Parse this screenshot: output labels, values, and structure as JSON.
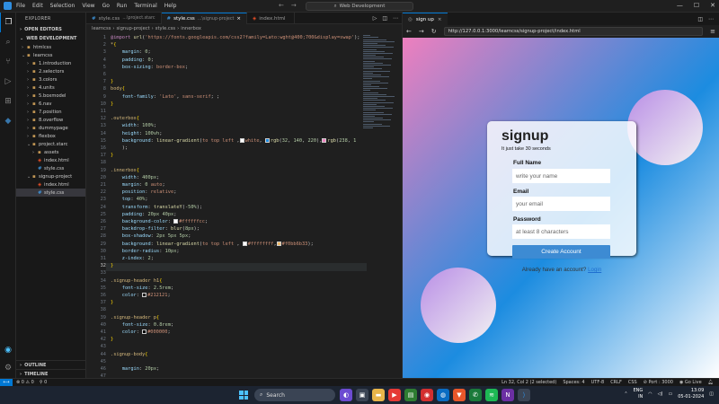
{
  "titlebar": {
    "menu": [
      "File",
      "Edit",
      "Selection",
      "View",
      "Go",
      "Run",
      "Terminal",
      "Help"
    ],
    "command_center": "Web Development",
    "nav_back": "←",
    "nav_fwd": "→"
  },
  "sidebar": {
    "header": "EXPLORER",
    "open_editors": "OPEN EDITORS",
    "workspace": "WEB DEVELOPMENT",
    "items": [
      {
        "label": "htmlcss",
        "indent": 1,
        "type": "folder",
        "chev": "›"
      },
      {
        "label": "learncss",
        "indent": 1,
        "type": "folder",
        "chev": "⌄"
      },
      {
        "label": "1.introduction",
        "indent": 2,
        "type": "folder",
        "chev": "›"
      },
      {
        "label": "2.selectors",
        "indent": 2,
        "type": "folder",
        "chev": "›"
      },
      {
        "label": "3.colors",
        "indent": 2,
        "type": "folder",
        "chev": "›"
      },
      {
        "label": "4.units",
        "indent": 2,
        "type": "folder",
        "chev": "›"
      },
      {
        "label": "5.boxmodel",
        "indent": 2,
        "type": "folder",
        "chev": "›"
      },
      {
        "label": "6.nav",
        "indent": 2,
        "type": "folder",
        "chev": "›"
      },
      {
        "label": "7.position",
        "indent": 2,
        "type": "folder",
        "chev": "›"
      },
      {
        "label": "8.overflow",
        "indent": 2,
        "type": "folder",
        "chev": "›"
      },
      {
        "label": "dummypage",
        "indent": 2,
        "type": "folder",
        "chev": "›"
      },
      {
        "label": "flexbox",
        "indent": 2,
        "type": "folder",
        "chev": "›"
      },
      {
        "label": "project.starc",
        "indent": 2,
        "type": "folder",
        "chev": "⌄"
      },
      {
        "label": "assets",
        "indent": 3,
        "type": "folder",
        "chev": "›"
      },
      {
        "label": "index.html",
        "indent": 3,
        "type": "html",
        "chev": ""
      },
      {
        "label": "style.css",
        "indent": 3,
        "type": "css",
        "chev": ""
      },
      {
        "label": "signup-project",
        "indent": 2,
        "type": "folder",
        "chev": "⌄"
      },
      {
        "label": "index.html",
        "indent": 3,
        "type": "html",
        "chev": ""
      },
      {
        "label": "style.css",
        "indent": 3,
        "type": "css",
        "chev": "",
        "selected": true
      }
    ],
    "outline": "OUTLINE",
    "timeline": "TIMELINE"
  },
  "editor": {
    "tabs": [
      {
        "label": "style.css",
        "sub": "...\\project.starc",
        "active": false,
        "icon": "css"
      },
      {
        "label": "style.css",
        "sub": "...\\signup-project",
        "active": true,
        "icon": "css",
        "close": "×"
      },
      {
        "label": "index.html",
        "sub": "",
        "active": false,
        "icon": "html"
      }
    ],
    "breadcrumb": [
      "learncss",
      "signup-project",
      "style.css",
      "innerbox"
    ],
    "breadcrumb_sep": "›",
    "code": [
      {
        "n": 1,
        "html": "<span class='t-at'>@import</span> <span class='t-fn'>url</span>(<span class='t-str'>'https://fonts.googleapis.com/css2?family=Lato:wght@400;700&display=swap'</span>);"
      },
      {
        "n": 2,
        "html": "<span class='t-sel'>*</span><span class='t-br'>{</span>"
      },
      {
        "n": 3,
        "html": "    <span class='t-prop'>margin</span>: <span class='t-num'>0</span>;"
      },
      {
        "n": 4,
        "html": "    <span class='t-prop'>padding</span>: <span class='t-num'>0</span>;"
      },
      {
        "n": 5,
        "html": "    <span class='t-prop'>box-sizing</span>: <span class='t-val'>border-box</span>;"
      },
      {
        "n": 6,
        "html": ""
      },
      {
        "n": 7,
        "html": "<span class='t-br'>}</span>"
      },
      {
        "n": 8,
        "html": "<span class='t-sel'>body</span><span class='t-br'>{</span>"
      },
      {
        "n": 9,
        "html": "    <span class='t-prop'>font-family</span>: <span class='t-str'>'Lato'</span>, <span class='t-val'>sans-serif</span>; ;"
      },
      {
        "n": 10,
        "html": "<span class='t-br'>}</span>"
      },
      {
        "n": 11,
        "html": ""
      },
      {
        "n": 12,
        "html": "<span class='t-sel'>.outerbox</span><span class='t-br'>{</span>"
      },
      {
        "n": 13,
        "html": "    <span class='t-prop'>width</span>: <span class='t-num'>100%</span>;"
      },
      {
        "n": 14,
        "html": "    <span class='t-prop'>height</span>: <span class='t-num'>100vh</span>;"
      },
      {
        "n": 15,
        "html": "    <span class='t-prop'>background</span>: <span class='t-fn'>linear-gradient</span>(<span class='t-val'>to top left</span> ,<span class='sw' style='background:#fff'></span><span class='t-val'>white</span>, <span class='sw' style='background:#1c8ce0'></span><span class='t-fn'>rgb</span>(<span class='t-num'>32</span>, <span class='t-num'>140</span>, <span class='t-num'>220</span>),<span class='sw' style='background:#ee7fbe'></span><span class='t-fn'>rgb</span>(<span class='t-num'>238</span>, <span class='t-num'>1</span>"
      },
      {
        "n": 16,
        "html": "    );"
      },
      {
        "n": 17,
        "html": "<span class='t-br'>}</span>"
      },
      {
        "n": 18,
        "html": ""
      },
      {
        "n": 19,
        "html": "<span class='t-sel'>.innerbox</span><span class='t-br'>{</span>"
      },
      {
        "n": 20,
        "html": "    <span class='t-prop'>width</span>: <span class='t-num'>400px</span>;"
      },
      {
        "n": 21,
        "html": "    <span class='t-prop'>margin</span>: <span class='t-num'>0</span> <span class='t-val'>auto</span>;"
      },
      {
        "n": 22,
        "html": "    <span class='t-prop'>position</span>: <span class='t-val'>relative</span>;"
      },
      {
        "n": 23,
        "html": "    <span class='t-prop'>top</span>: <span class='t-num'>40%</span>;"
      },
      {
        "n": 24,
        "html": "    <span class='t-prop'>transform</span>: <span class='t-fn'>translateY</span>(<span class='t-num'>-50%</span>);"
      },
      {
        "n": 25,
        "html": "    <span class='t-prop'>padding</span>: <span class='t-num'>20px</span> <span class='t-num'>40px</span>;"
      },
      {
        "n": 26,
        "html": "    <span class='t-prop'>background-color</span>: <span class='sw' style='background:#fff'></span><span class='t-val'>#ffffffcc</span>;"
      },
      {
        "n": 27,
        "html": "    <span class='t-prop'>backdrop-filter</span>: <span class='t-fn'>blur</span>(<span class='t-num'>8px</span>);"
      },
      {
        "n": 28,
        "html": "    <span class='t-prop'>box-shadow</span>: <span class='t-num'>2px</span> <span class='t-num'>5px</span> <span class='t-num'>5px</span>;"
      },
      {
        "n": 29,
        "html": "    <span class='t-prop'>background</span>: <span class='t-fn'>linear-gradient</span>(<span class='t-val'>to top left</span> , <span class='sw' style='background:#fff'></span><span class='t-val'>#ffffffff</span>,<span class='sw' style='background:#f0bb6b'></span><span class='t-val'>#f0bb6b33</span>);"
      },
      {
        "n": 30,
        "html": "    <span class='t-prop'>border-radius</span>: <span class='t-num'>10px</span>;"
      },
      {
        "n": 31,
        "html": "    <span class='t-prop'>z-index</span>: <span class='t-num'>2</span>;"
      },
      {
        "n": 32,
        "html": "<span class='t-br'>}</span>",
        "cur": true
      },
      {
        "n": 33,
        "html": ""
      },
      {
        "n": 34,
        "html": "<span class='t-sel'>.signup-header h1</span><span class='t-br'>{</span>"
      },
      {
        "n": 35,
        "html": "    <span class='t-prop'>font-size</span>: <span class='t-num'>2.5rem</span>;"
      },
      {
        "n": 36,
        "html": "    <span class='t-prop'>color</span>: <span class='sw' style='background:#212121'></span><span class='t-val'>#212121</span>;"
      },
      {
        "n": 37,
        "html": "<span class='t-br'>}</span>"
      },
      {
        "n": 38,
        "html": ""
      },
      {
        "n": 39,
        "html": "<span class='t-sel'>.signup-header p</span><span class='t-br'>{</span>"
      },
      {
        "n": 40,
        "html": "    <span class='t-prop'>font-size</span>: <span class='t-num'>0.8rem</span>;"
      },
      {
        "n": 41,
        "html": "    <span class='t-prop'>color</span>: <span class='sw' style='background:#000'></span><span class='t-val'>#000000</span>;"
      },
      {
        "n": 42,
        "html": "<span class='t-br'>}</span>"
      },
      {
        "n": 43,
        "html": ""
      },
      {
        "n": 44,
        "html": "<span class='t-sel'>.signup-body</span><span class='t-br'>{</span>"
      },
      {
        "n": 45,
        "html": ""
      },
      {
        "n": 46,
        "html": "    <span class='t-prop'>margin</span>: <span class='t-num'>20px</span>;"
      },
      {
        "n": 47,
        "html": ""
      },
      {
        "n": 48,
        "html": "<span class='t-br'>}</span>"
      }
    ]
  },
  "browser": {
    "tab_label": "sign up",
    "url": "http://127.0.0.1:3000/learncss/signup-project/index.html"
  },
  "signup": {
    "title": "signup",
    "subtitle": "It just take 30 seconds",
    "fields": [
      {
        "label": "Full Name",
        "placeholder": "write your name"
      },
      {
        "label": "Email",
        "placeholder": "your email"
      },
      {
        "label": "Password",
        "placeholder": "at least 8 characters"
      }
    ],
    "button": "Create Account",
    "account_text": "Already have an account?",
    "login_link": "Login"
  },
  "statusbar": {
    "errors": "0",
    "warnings": "0",
    "ports": "0",
    "position": "Ln 32, Col 2 (2 selected)",
    "spaces": "Spaces: 4",
    "encoding": "UTF-8",
    "eol": "CRLF",
    "lang": "CSS",
    "port": "Port : 3000",
    "golive": "Go Live"
  },
  "taskbar": {
    "search": "Search",
    "lang_top": "ENG",
    "lang_bottom": "IN",
    "time": "13:09",
    "date": "05-01-2024"
  },
  "colors": {
    "accent": "#0078d4",
    "button": "#3d8bd3"
  }
}
